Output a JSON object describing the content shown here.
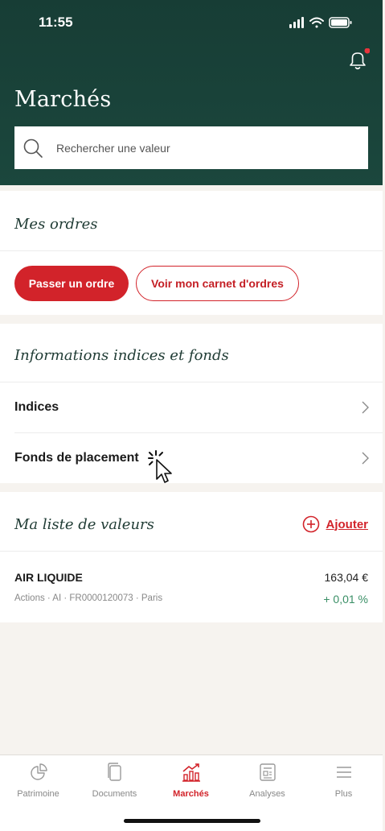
{
  "status_bar": {
    "time": "11:55"
  },
  "header": {
    "title": "Marchés",
    "search_placeholder": "Rechercher une valeur"
  },
  "orders": {
    "title": "Mes ordres",
    "primary_button": "Passer un ordre",
    "secondary_button": "Voir mon carnet d'ordres"
  },
  "info": {
    "title": "Informations indices et fonds",
    "items": [
      {
        "label": "Indices"
      },
      {
        "label": "Fonds de placement"
      }
    ]
  },
  "watchlist": {
    "title": "Ma liste de valeurs",
    "add_label": "Ajouter",
    "items": [
      {
        "name": "AIR LIQUIDE",
        "meta": "Actions · AI · FR0000120073 · Paris",
        "price": "163,04 €",
        "change": "+ 0,01 %"
      }
    ]
  },
  "tabbar": {
    "tabs": [
      {
        "label": "Patrimoine",
        "icon": "pie-chart-icon"
      },
      {
        "label": "Documents",
        "icon": "documents-icon"
      },
      {
        "label": "Marchés",
        "icon": "markets-chart-icon",
        "active": true
      },
      {
        "label": "Analyses",
        "icon": "newspaper-icon"
      },
      {
        "label": "Plus",
        "icon": "menu-icon"
      }
    ]
  },
  "colors": {
    "header_bg": "#1b473d",
    "accent_red": "#d2232a",
    "positive_green": "#3a8f66",
    "page_bg": "#f6f3ef"
  }
}
